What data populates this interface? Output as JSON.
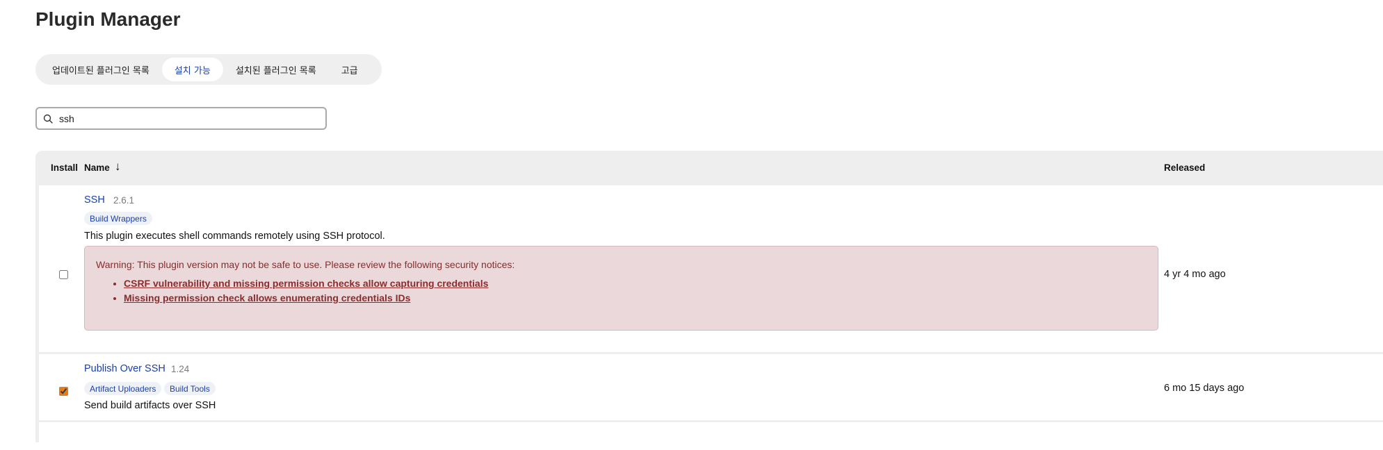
{
  "page": {
    "title": "Plugin Manager"
  },
  "tabs": [
    {
      "label": "업데이트된 플러그인 목록",
      "active": false
    },
    {
      "label": "설치 가능",
      "active": true
    },
    {
      "label": "설치된 플러그인 목록",
      "active": false
    },
    {
      "label": "고급",
      "active": false
    }
  ],
  "search": {
    "value": "ssh",
    "icon": "search-icon"
  },
  "table": {
    "headers": {
      "install": "Install",
      "name": "Name",
      "sort_indicator": "↓",
      "released": "Released"
    },
    "rows": [
      {
        "checked": false,
        "name": "SSH",
        "version": "2.6.1",
        "tags": [
          "Build Wrappers"
        ],
        "description": "This plugin executes shell commands remotely using SSH protocol.",
        "warning": {
          "text": "Warning: This plugin version may not be safe to use. Please review the following security notices:",
          "links": [
            "CSRF vulnerability and missing permission checks allow capturing credentials",
            "Missing permission check allows enumerating credentials IDs"
          ]
        },
        "released": "4 yr 4 mo ago"
      },
      {
        "checked": true,
        "name": "Publish Over SSH",
        "version": "1.24",
        "tags": [
          "Artifact Uploaders",
          "Build Tools"
        ],
        "description": "Send build artifacts over SSH",
        "released": "6 mo 15 days ago"
      }
    ]
  },
  "colors": {
    "link": "#1a3fa8",
    "warning_bg": "#ead8da",
    "warning_text": "#8a2c2c",
    "checkbox_checked": "#e37d1b"
  }
}
